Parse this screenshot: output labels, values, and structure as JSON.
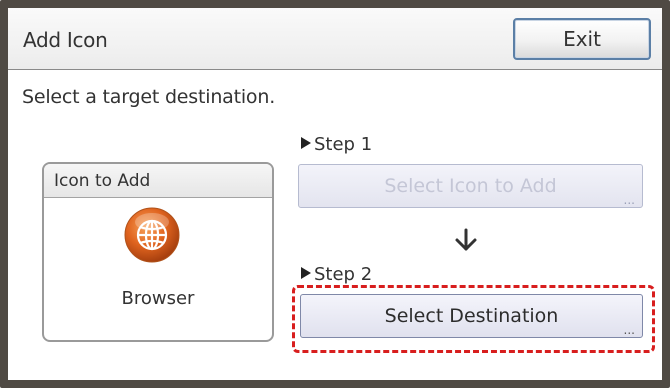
{
  "window": {
    "title": "Add Icon",
    "exit_label": "Exit"
  },
  "instruction": "Select a target destination.",
  "icon_panel": {
    "header": "Icon to Add",
    "icon_name": "browser-globe-icon",
    "icon_label": "Browser"
  },
  "steps": {
    "step1_label": "Step 1",
    "step1_button": "Select Icon to Add",
    "step1_button_state": "disabled",
    "step2_label": "Step 2",
    "step2_button": "Select Destination",
    "more_indicator": "..."
  },
  "colors": {
    "highlight": "#d81e1e",
    "browser_icon_orange": "#e0641f"
  }
}
